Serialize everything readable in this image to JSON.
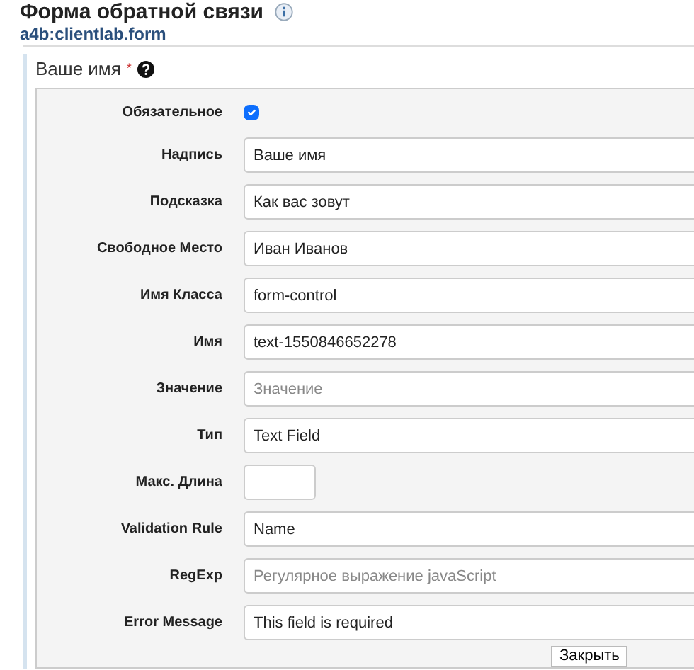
{
  "header": {
    "title": "Форма обратной связи",
    "subtitle": "a4b:clientlab.form"
  },
  "field": {
    "label": "Ваше имя",
    "required_mark": "*"
  },
  "properties": [
    {
      "kind": "checkbox",
      "label": "Обязательное",
      "checked": true
    },
    {
      "kind": "text",
      "label": "Надпись",
      "value": "Ваше имя"
    },
    {
      "kind": "text",
      "label": "Подсказка",
      "value": "Как вас зовут"
    },
    {
      "kind": "text",
      "label": "Свободное Место",
      "value": "Иван Иванов"
    },
    {
      "kind": "text",
      "label": "Имя Класса",
      "value": "form-control"
    },
    {
      "kind": "text",
      "label": "Имя",
      "value": "text-1550846652278"
    },
    {
      "kind": "text",
      "label": "Значение",
      "placeholder": "Значение"
    },
    {
      "kind": "text",
      "label": "Тип",
      "value": "Text Field"
    },
    {
      "kind": "short",
      "label": "Макс. Длина"
    },
    {
      "kind": "text",
      "label": "Validation Rule",
      "value": "Name"
    },
    {
      "kind": "text",
      "label": "RegExp",
      "placeholder": "Регулярное выражение javaScript"
    },
    {
      "kind": "text",
      "label": "Error Message",
      "value": "This field is required"
    }
  ],
  "close_button": "Закрыть"
}
